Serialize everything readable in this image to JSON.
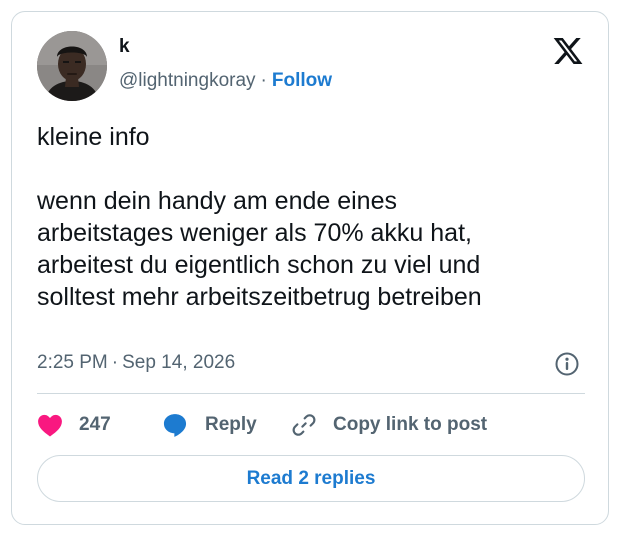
{
  "author": {
    "name": "k",
    "handle": "@lightningkoray",
    "separator": "·",
    "follow_label": "Follow"
  },
  "tweet": {
    "lines": [
      "kleine info",
      "",
      "wenn dein handy am ende eines",
      "arbeitstages weniger als 70% akku hat,",
      "arbeitest du eigentlich schon zu viel und",
      "solltest mehr arbeitszeitbetrug betreiben"
    ],
    "time": "2:25 PM",
    "separator": "·",
    "date": "Sep 14, 2026"
  },
  "actions": {
    "like_count": "247",
    "reply_label": "Reply",
    "copy_label": "Copy link to post"
  },
  "read_replies_label": "Read 2 replies",
  "icons": {
    "brand": "x-logo-icon",
    "info": "info-icon",
    "like": "heart-icon",
    "reply": "speech-bubble-icon",
    "copy": "link-icon"
  },
  "colors": {
    "accent": "#1d7bd0",
    "heart": "#f91880",
    "muted": "#536471",
    "text": "#0f1419",
    "border": "#cfd9de"
  }
}
